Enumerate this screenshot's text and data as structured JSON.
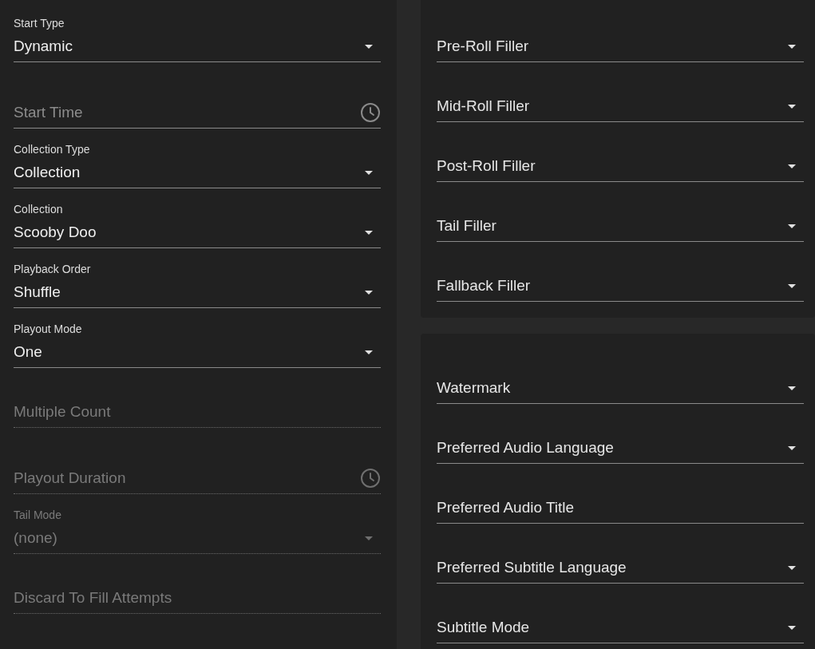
{
  "left_panel": {
    "fields": [
      {
        "kind": "select",
        "label": "Start Type",
        "value": "Dynamic",
        "disabled": false
      },
      {
        "kind": "time",
        "label": "Start Time",
        "disabled": false
      },
      {
        "kind": "select",
        "label": "Collection Type",
        "value": "Collection",
        "disabled": false
      },
      {
        "kind": "select",
        "label": "Collection",
        "value": "Scooby Doo",
        "disabled": false
      },
      {
        "kind": "select",
        "label": "Playback Order",
        "value": "Shuffle",
        "disabled": false
      },
      {
        "kind": "select",
        "label": "Playout Mode",
        "value": "One",
        "disabled": false
      },
      {
        "kind": "text",
        "label": "Multiple Count",
        "disabled": true
      },
      {
        "kind": "time",
        "label": "Playout Duration",
        "disabled": true
      },
      {
        "kind": "select",
        "label": "Tail Mode",
        "value": "(none)",
        "disabled": true
      },
      {
        "kind": "text",
        "label": "Discard To Fill Attempts",
        "disabled": true
      }
    ]
  },
  "filler_card": {
    "fields": [
      {
        "kind": "select",
        "label": "Pre-Roll Filler",
        "disabled": false
      },
      {
        "kind": "select",
        "label": "Mid-Roll Filler",
        "disabled": false
      },
      {
        "kind": "select",
        "label": "Post-Roll Filler",
        "disabled": false
      },
      {
        "kind": "select",
        "label": "Tail Filler",
        "disabled": false
      },
      {
        "kind": "select",
        "label": "Fallback Filler",
        "disabled": false
      }
    ]
  },
  "stream_card": {
    "fields": [
      {
        "kind": "select",
        "label": "Watermark",
        "disabled": false
      },
      {
        "kind": "select",
        "label": "Preferred Audio Language",
        "disabled": false
      },
      {
        "kind": "text",
        "label": "Preferred Audio Title",
        "disabled": false
      },
      {
        "kind": "select",
        "label": "Preferred Subtitle Language",
        "disabled": false
      },
      {
        "kind": "select",
        "label": "Subtitle Mode",
        "disabled": false
      }
    ]
  }
}
